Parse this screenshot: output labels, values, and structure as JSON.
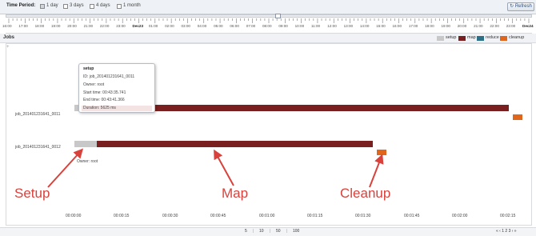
{
  "toolbar": {
    "time_period_label": "Time Period:",
    "options": [
      {
        "label": "1 day",
        "checked": true
      },
      {
        "label": "3 days",
        "checked": false
      },
      {
        "label": "4 days",
        "checked": false
      },
      {
        "label": "1 month",
        "checked": false
      }
    ],
    "refresh_label": "Refresh"
  },
  "timeline": {
    "tick_labels": [
      "16:00",
      "17:00",
      "18:00",
      "19:00",
      "20:00",
      "21:00",
      "22:00",
      "23:00",
      "Dec23",
      "01:00",
      "02:00",
      "03:00",
      "04:00",
      "05:00",
      "06:00",
      "07:00",
      "08:00",
      "09:00",
      "10:00",
      "11:00",
      "12:00",
      "13:00",
      "14:00",
      "15:00",
      "16:00",
      "17:00",
      "18:00",
      "19:00",
      "20:00",
      "21:00",
      "22:00",
      "23:00",
      "Dec24"
    ]
  },
  "header": {
    "jobs_label": "Jobs",
    "legend": [
      {
        "label": "setup",
        "color": "#c8c8c8"
      },
      {
        "label": "map",
        "color": "#7a1f1f"
      },
      {
        "label": "reduce",
        "color": "#2d6f86"
      },
      {
        "label": "cleanup",
        "color": "#e0661c"
      }
    ]
  },
  "chart": {
    "rows": [
      {
        "label": "job_201401231641_0011"
      },
      {
        "label": "job_201401231641_0012"
      }
    ],
    "owner_text": "Owner: root",
    "x_labels": [
      "00:00:00",
      "00:00:15",
      "00:00:30",
      "00:00:45",
      "00:01:00",
      "00:01:15",
      "00:01:30",
      "00:01:45",
      "00:02:00",
      "00:02:15"
    ]
  },
  "tooltip": {
    "title": "setup",
    "id_line": "ID: job_201401231641_0011",
    "owner_line": "Owner: root",
    "start_line": "Start time: 00:43:35.741",
    "end_line": "End time: 00:43:41.366",
    "duration_line": "Duration: 5625 ms"
  },
  "annotations": {
    "setup": "Setup",
    "map": "Map",
    "cleanup": "Cleanup"
  },
  "pager": {
    "sizes": [
      "5",
      "10",
      "50",
      "100"
    ],
    "nav": "« ‹ 1 2 3 › »"
  },
  "colors": {
    "setup": "#c8c8c8",
    "map": "#7a1f1f",
    "cleanup": "#e0661c",
    "annotation": "#d9423c"
  },
  "icons": [
    "refresh-icon",
    "arrow-icon"
  ]
}
